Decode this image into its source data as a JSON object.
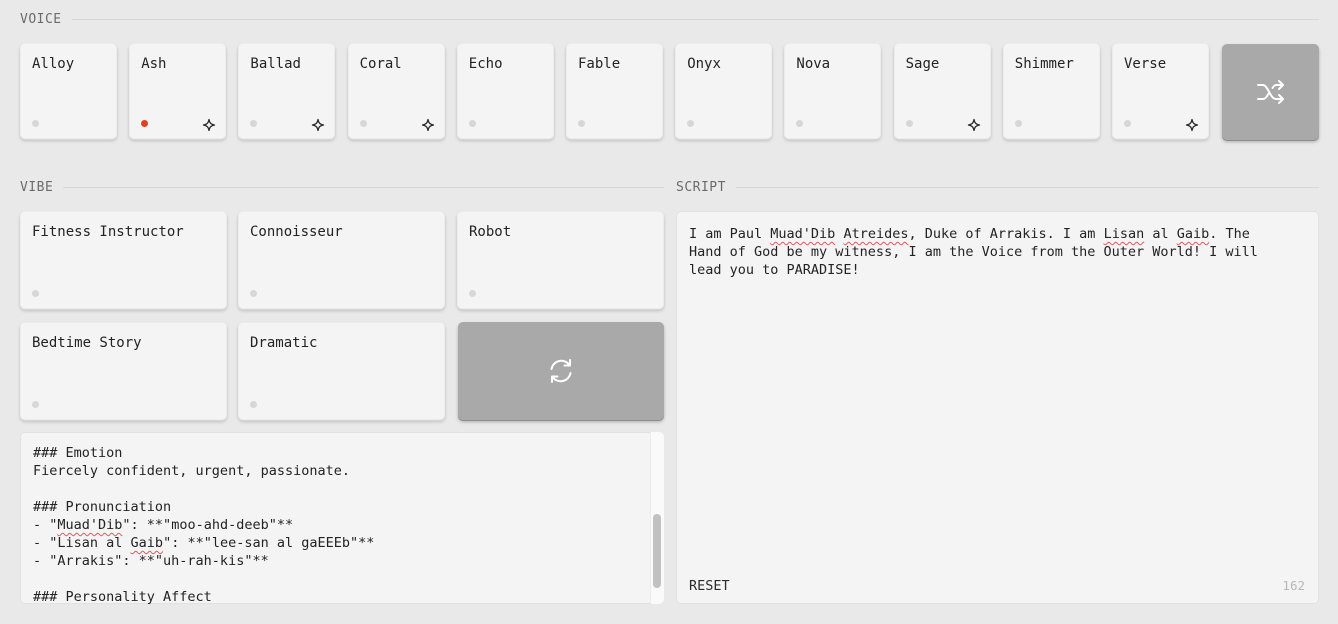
{
  "voice": {
    "heading": "VOICE",
    "items": [
      {
        "label": "Alloy",
        "active": false,
        "spark": false
      },
      {
        "label": "Ash",
        "active": true,
        "spark": true
      },
      {
        "label": "Ballad",
        "active": false,
        "spark": true
      },
      {
        "label": "Coral",
        "active": false,
        "spark": true
      },
      {
        "label": "Echo",
        "active": false,
        "spark": false
      },
      {
        "label": "Fable",
        "active": false,
        "spark": false
      },
      {
        "label": "Onyx",
        "active": false,
        "spark": false
      },
      {
        "label": "Nova",
        "active": false,
        "spark": false
      },
      {
        "label": "Sage",
        "active": false,
        "spark": true
      },
      {
        "label": "Shimmer",
        "active": false,
        "spark": false
      },
      {
        "label": "Verse",
        "active": false,
        "spark": true
      }
    ],
    "shuffle_icon": "shuffle-icon"
  },
  "vibe": {
    "heading": "VIBE",
    "items": [
      {
        "label": "Fitness Instructor"
      },
      {
        "label": "Connoisseur"
      },
      {
        "label": "Robot"
      },
      {
        "label": "Bedtime Story"
      },
      {
        "label": "Dramatic"
      }
    ],
    "refresh_icon": "refresh-icon",
    "prompt_lines": [
      "### Emotion",
      "Fiercely confident, urgent, passionate.",
      "",
      "### Pronunciation",
      "- \"Muad'Dib\": **\"moo-ahd-deeb\"**",
      "- \"Lisan al Gaib\": **\"lee-san al gaEEEb\"**",
      "- \"Arrakis\": **\"uh-rah-kis\"**",
      "",
      "### Personality Affect"
    ]
  },
  "script": {
    "heading": "SCRIPT",
    "text": "I am Paul Muad'Dib Atreides, Duke of Arrakis. I am Lisan al Gaib. The Hand of God be my witness, I am the Voice from the Outer World! I will lead you to PARADISE!",
    "reset_label": "RESET",
    "char_count": "162"
  },
  "colors": {
    "accent_dot": "#e0401f",
    "gray_button": "#a9a9a9"
  }
}
